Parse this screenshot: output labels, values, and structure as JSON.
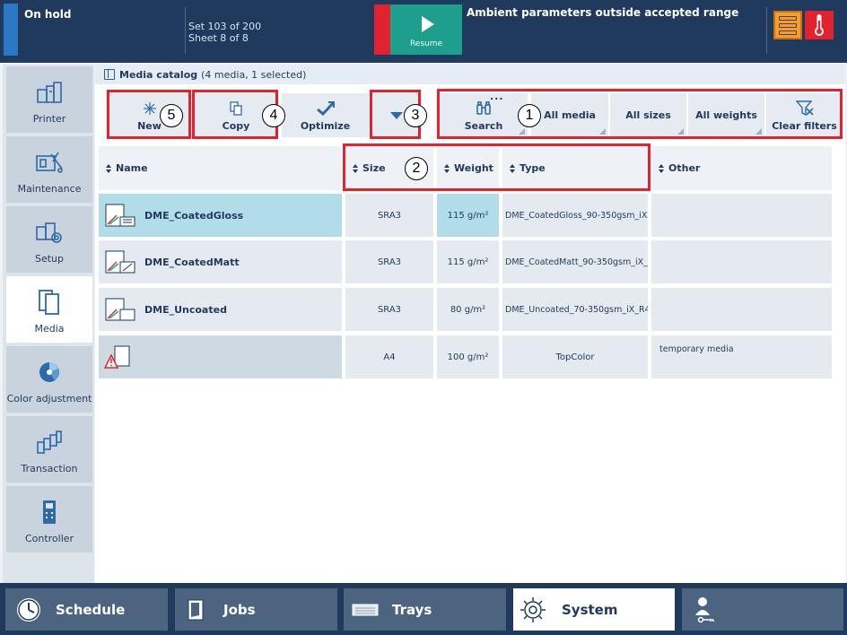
{
  "status": {
    "state": "On hold",
    "set_info": "Set 103 of 200",
    "sheet_info": "Sheet 8 of 8",
    "resume_label": "Resume",
    "message": "Ambient parameters outside accepted range",
    "colors": {
      "status_blue": "#2d78c4",
      "alert_red": "#e2222e",
      "resume_teal": "#1e9e8c",
      "warning_orange": "#f0a030"
    }
  },
  "sidebar": {
    "items": [
      {
        "label": "Printer",
        "icon": "printer-icon"
      },
      {
        "label": "Maintenance",
        "icon": "maintenance-icon"
      },
      {
        "label": "Setup",
        "icon": "setup-icon"
      },
      {
        "label": "Media",
        "icon": "media-icon",
        "active": true
      },
      {
        "label": "Color adjustment",
        "icon": "color-adjustment-icon"
      },
      {
        "label": "Transaction",
        "icon": "transaction-icon"
      },
      {
        "label": "Controller",
        "icon": "controller-icon"
      }
    ]
  },
  "catalog": {
    "title": "Media catalog",
    "subtitle": "(4 media, 1 selected)"
  },
  "toolbar": {
    "new_label": "New",
    "copy_label": "Copy",
    "optimize_label": "Optimize",
    "search_label": "Search",
    "more_label": "...",
    "all_media_label": "All media",
    "all_sizes_label": "All sizes",
    "all_weights_label": "All weights",
    "clear_filters_label": "Clear filters"
  },
  "annotations": [
    "1",
    "2",
    "3",
    "4",
    "5"
  ],
  "table": {
    "headers": {
      "name": "Name",
      "size": "Size",
      "weight": "Weight",
      "type": "Type",
      "other": "Other"
    },
    "rows": [
      {
        "name": "DME_CoatedGloss",
        "size": "SRA3",
        "weight": "115 g/m²",
        "type": "DME_CoatedGloss_90-350gsm_iX...",
        "other": "",
        "selected": true,
        "icon": "coated-gloss-media-icon"
      },
      {
        "name": "DME_CoatedMatt",
        "size": "SRA3",
        "weight": "115 g/m²",
        "type": "DME_CoatedMatt_90-350gsm_iX_...",
        "other": "",
        "selected": false,
        "icon": "coated-matt-media-icon"
      },
      {
        "name": "DME_Uncoated",
        "size": "SRA3",
        "weight": "80 g/m²",
        "type": "DME_Uncoated_70-350gsm_iX_R4...",
        "other": "",
        "selected": false,
        "icon": "uncoated-media-icon"
      },
      {
        "name": "",
        "size": "A4",
        "weight": "100 g/m²",
        "type": "TopColor",
        "other": "temporary media",
        "selected": false,
        "icon": "temporary-media-warning-icon"
      }
    ]
  },
  "bottom_nav": {
    "schedule": "Schedule",
    "jobs": "Jobs",
    "trays": "Trays",
    "system": "System"
  }
}
